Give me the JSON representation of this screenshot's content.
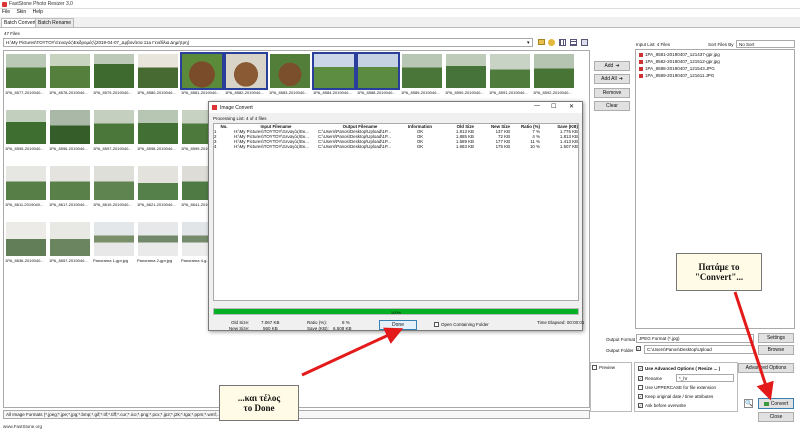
{
  "window": {
    "title": "FastStone Photo Resizer 3.0"
  },
  "menu": [
    "File",
    "Skin",
    "Help"
  ],
  "tabs": [
    "Batch Convert",
    "Batch Rename"
  ],
  "browser": {
    "file_count": "47 Files",
    "path": "H:\\My Pictures\\ΤΟΥΤΟΥ\\Ξεναγός\\Εκδρομές\\(2019-04-07_Δρβονίτσα 11a Γενέθλια Δημήτρη)",
    "thumbs_row1": [
      "1PA_8577-2019040...",
      "1PA_8578-2019040...",
      "1PA_8579-2019040...",
      "1PA_8580-2019040...",
      "1PA_8581-2019040...",
      "1PA_8582-2019040...",
      "1PA_8583-2019040...",
      "1PA_8584-2019040...",
      "1PA_8588-2019040...",
      "1PA_8589-2019040...",
      "1PA_8590-2019040...",
      "1PA_8591-2019040...",
      "1PA_8592-2019040...",
      "1PA_8593-2019040..."
    ],
    "thumbs_row2": [
      "1PA_8595-2019040...",
      "1PA_8596-2019040...",
      "1PA_8597-2019040...",
      "1PA_8598-2019040...",
      "1PA_8599-2019040..."
    ],
    "thumbs_row3": [
      "1PA_8611-2019040...",
      "1PA_8617-2019040...",
      "1PA_8619-2019040...",
      "1PA_8621-2019040...",
      "1PA_8641-2019040..."
    ],
    "thumbs_row4": [
      "1PA_8636-2019040...",
      "1PA_8657-2019040...",
      "Panorama 1-gpr.jpg",
      "Panorama 2-gpr.jpg",
      "Panorama 4-g..."
    ],
    "filter": "All Image Formats (*.jpeg;*.jpe;*.jpg;*.bmp;*.gif;*.tif;*.tiff;*.cur;*.ico;*.png;*.pcx;*.jp2;*.j2k;*.tga;*.ppm;*.wmf;...)",
    "footer": "www.FastStone.org"
  },
  "input_list": {
    "label": "Input List: 4 Files",
    "sort_label": "Sort Files By",
    "sort_value": "No Sort",
    "files": [
      "1PA_8581-20190407_121437-gpr.jpg",
      "1PA_8582-20190407_121512-gpr.jpg",
      "1PA_8588-20190407_121543.JPG",
      "1PA_8589-20190407_121611.JPG"
    ]
  },
  "buttons": {
    "add": "Add",
    "add_all": "Add All",
    "remove": "Remove",
    "clear": "Clear",
    "settings": "Settings",
    "browse": "Browse",
    "advanced": "Advanced Options",
    "convert": "Convert",
    "close": "Close"
  },
  "output": {
    "format_label": "Output Format",
    "format_value": "JPEG Format (*.jpg)",
    "folder_label": "Output Folder",
    "folder_value": "C:\\Users\\Panos\\Desktop\\Upload"
  },
  "options": {
    "use_advanced": "Use Advanced Options ( Resize ... )",
    "rename": "Rename",
    "rename_value": "*_hr",
    "uppercase": "Use UPPERCASE for file extension",
    "keep_date": "Keep original date / time attributes",
    "ask": "Ask before overwrite",
    "preview": "Preview"
  },
  "dialog": {
    "title": "Image Convert",
    "processing": "Processing List: 4 of 4 files",
    "headers": [
      "No.",
      "Input Filename",
      "Output Filename",
      "Information",
      "Old Size",
      "New Size",
      "Ratio (%)",
      "Save (KB)"
    ],
    "rows": [
      [
        "1",
        "H:\\My Pictures\\ΤΟΥΤΟΥ\\Ξεναγός\\Εκ...",
        "C:\\Users\\Panos\\Desktop\\Upload\\1P...",
        "OK",
        "1.913 KB",
        "137 KB",
        "7 %",
        "1.776 KB"
      ],
      [
        "2",
        "H:\\My Pictures\\ΤΟΥΤΟΥ\\Ξεναγός\\Εκ...",
        "C:\\Users\\Panos\\Desktop\\Upload\\1P...",
        "OK",
        "1.885 KB",
        "72 KB",
        "4 %",
        "1.813 KB"
      ],
      [
        "3",
        "H:\\My Pictures\\ΤΟΥΤΟΥ\\Ξεναγός\\Εκ...",
        "C:\\Users\\Panos\\Desktop\\Upload\\1P...",
        "OK",
        "1.589 KB",
        "177 KB",
        "11 %",
        "1.413 KB"
      ],
      [
        "4",
        "H:\\My Pictures\\ΤΟΥΤΟΥ\\Ξεναγός\\Εκ...",
        "C:\\Users\\Panos\\Desktop\\Upload\\1P...",
        "OK",
        "1.683 KB",
        "175 KB",
        "10 %",
        "1.507 KB"
      ]
    ],
    "progress": 1.0,
    "progress_text": "100%",
    "old_size_label": "Old Size:",
    "old_size": "7.067 KB",
    "new_size_label": "New Size:",
    "new_size": "560 KB",
    "ratio_label": "Ratio (%):",
    "ratio": "8 %",
    "save_label": "Save (KB):",
    "save": "6.508 KB",
    "done": "Done",
    "open_folder": "Open Containing Folder",
    "elapsed": "Time Elapsed: 00:00:01"
  },
  "annotations": {
    "convert_note_1": "Πατάμε το",
    "convert_note_2": "\"Convert\"...",
    "done_note_1": "...και τέλος",
    "done_note_2": "το Done"
  },
  "colors": {
    "selection": "#2a3f9c",
    "progress": "#06b025",
    "arrow": "#e41a1a"
  }
}
